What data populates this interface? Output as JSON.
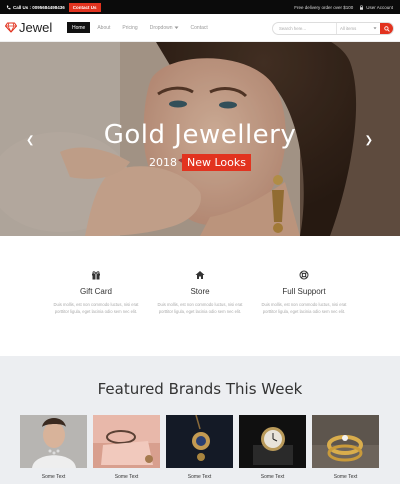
{
  "topbar": {
    "phone": "Call Us : 0095684498436",
    "contact_btn": "Contact Us",
    "delivery": "Free delivery order over $100",
    "user_account": "User Account"
  },
  "brand": {
    "name": "Jewel",
    "accent": "#e2331f"
  },
  "nav": [
    {
      "label": "Home",
      "active": true
    },
    {
      "label": "About"
    },
    {
      "label": "Pricing"
    },
    {
      "label": "Dropdown"
    },
    {
      "label": "Contact"
    }
  ],
  "search": {
    "placeholder": "Search here...",
    "category": "All items"
  },
  "hero": {
    "title": "Gold Jewellery",
    "year": "2018",
    "tag": "New Looks"
  },
  "features": [
    {
      "icon": "gift-icon",
      "title": "Gift Card",
      "desc_line1": "Duis mollis, est non commodo luctus, nisi erat",
      "desc_line2": "porttitor ligula, eget lacinia odio sem nec elit."
    },
    {
      "icon": "home-icon",
      "title": "Store",
      "desc_line1": "Duis mollis, est non commodo luctus, nisi erat",
      "desc_line2": "porttitor ligula, eget lacinia odio sem nec elit."
    },
    {
      "icon": "support-icon",
      "title": "Full Support",
      "desc_line1": "Duis mollis, est non commodo luctus, nisi erat",
      "desc_line2": "porttitor ligula, eget lacinia odio sem nec elit."
    }
  ],
  "brands": {
    "title": "Featured Brands This Week",
    "cards": [
      {
        "caption": "Some Text"
      },
      {
        "caption": "Some Text"
      },
      {
        "caption": "Some Text"
      },
      {
        "caption": "Some Text"
      },
      {
        "caption": "Some Text"
      }
    ]
  }
}
